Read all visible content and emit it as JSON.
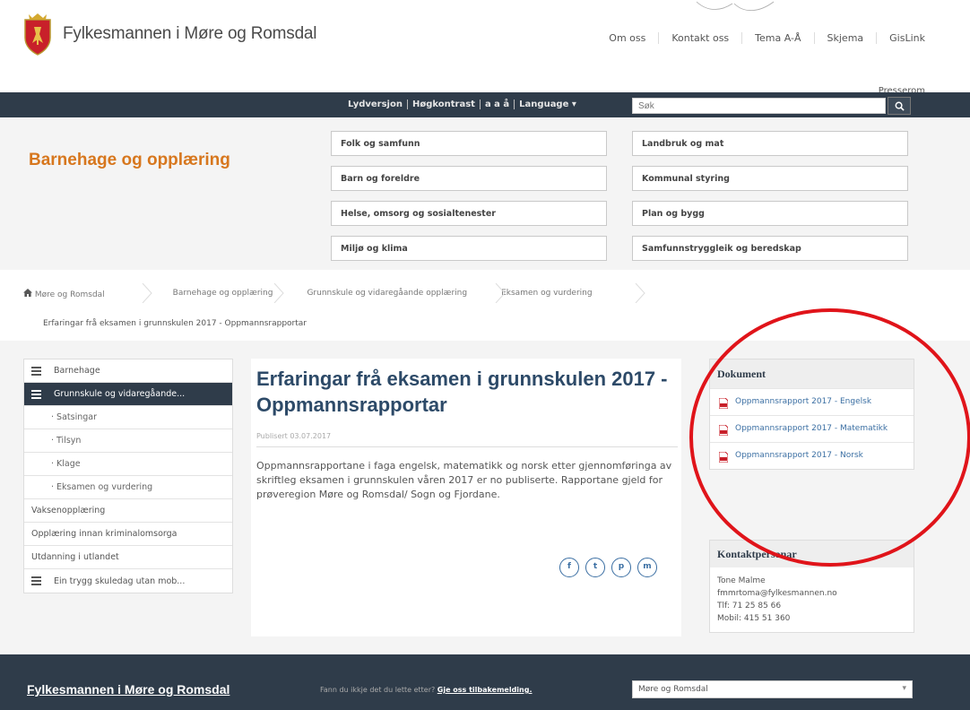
{
  "header": {
    "site_title": "Fylkesmannen i Møre og Romsdal",
    "top_links": [
      "Om oss",
      "Kontakt oss",
      "Tema A-Å",
      "Skjema",
      "GisLink"
    ],
    "press_link": "Presserom"
  },
  "utility_bar": {
    "links": [
      "Lydversjon",
      "Høgkontrast",
      "a a å",
      "Language"
    ],
    "search_placeholder": "Søk",
    "search_icon": "search-icon"
  },
  "section": {
    "title": "Barnehage og opplæring",
    "topics": [
      "Folk og samfunn",
      "Landbruk og mat",
      "Barn og foreldre",
      "Kommunal styring",
      "Helse, omsorg og sosialtenester",
      "Plan og bygg",
      "Miljø og klima",
      "Samfunnstryggleik og beredskap"
    ]
  },
  "breadcrumb": {
    "items": [
      "Møre og Romsdal",
      "Barnehage og opplæring",
      "Grunnskule og vidaregåande opplæring",
      "Eksamen og vurdering"
    ],
    "current": "Erfaringar frå eksamen i grunnskulen 2017 - Oppmannsrapportar"
  },
  "left_nav": {
    "items": [
      {
        "label": "Barnehage",
        "type": "top",
        "icon": true
      },
      {
        "label": "Grunnskule og vidaregåande...",
        "type": "active",
        "icon": true
      },
      {
        "label": "· Satsingar",
        "type": "sub"
      },
      {
        "label": "· Tilsyn",
        "type": "sub"
      },
      {
        "label": "· Klage",
        "type": "sub"
      },
      {
        "label": "· Eksamen og vurdering",
        "type": "sub"
      },
      {
        "label": "Vaksenopplæring",
        "type": "plain"
      },
      {
        "label": "Opplæring innan kriminalomsorga",
        "type": "plain"
      },
      {
        "label": "Utdanning i utlandet",
        "type": "plain"
      },
      {
        "label": "Ein trygg skuledag utan mob...",
        "type": "top",
        "icon": true
      }
    ]
  },
  "article": {
    "title": "Erfaringar frå eksamen i grunnskulen 2017 - Oppmannsrapportar",
    "published": "Publisert 03.07.2017",
    "body": "Oppmannsrapportane i faga engelsk, matematikk og norsk etter gjennomføringa av skriftleg eksamen i grunnskulen våren 2017 er no publiserte. Rapportane gjeld for prøveregion Møre og Romsdal/ Sogn og Fjordane.",
    "share_buttons": [
      "f",
      "t",
      "p",
      "m"
    ]
  },
  "documents": {
    "heading": "Dokument",
    "items": [
      "Oppmannsrapport 2017 - Engelsk",
      "Oppmannsrapport 2017 - Matematikk",
      "Oppmannsrapport 2017 - Norsk"
    ]
  },
  "contact": {
    "heading": "Kontaktpersonar",
    "lines": [
      "Tone Malme",
      "fmmrtoma@fylkesmannen.no",
      "Tlf: 71 25 85 66",
      "Mobil: 415 51 360"
    ]
  },
  "footer": {
    "title": "Fylkesmannen i Møre og Romsdal",
    "question": "Fann du ikkje det du lette etter?",
    "feedback_link": "Gje oss tilbakemelding.",
    "select_value": "Møre og Romsdal"
  },
  "colors": {
    "dark_bar": "#2f3c4a",
    "section_orange": "#d7771e",
    "title_blue": "#2d4a68",
    "link_blue": "#3b6fa3",
    "annotation_red": "#e0141a"
  }
}
